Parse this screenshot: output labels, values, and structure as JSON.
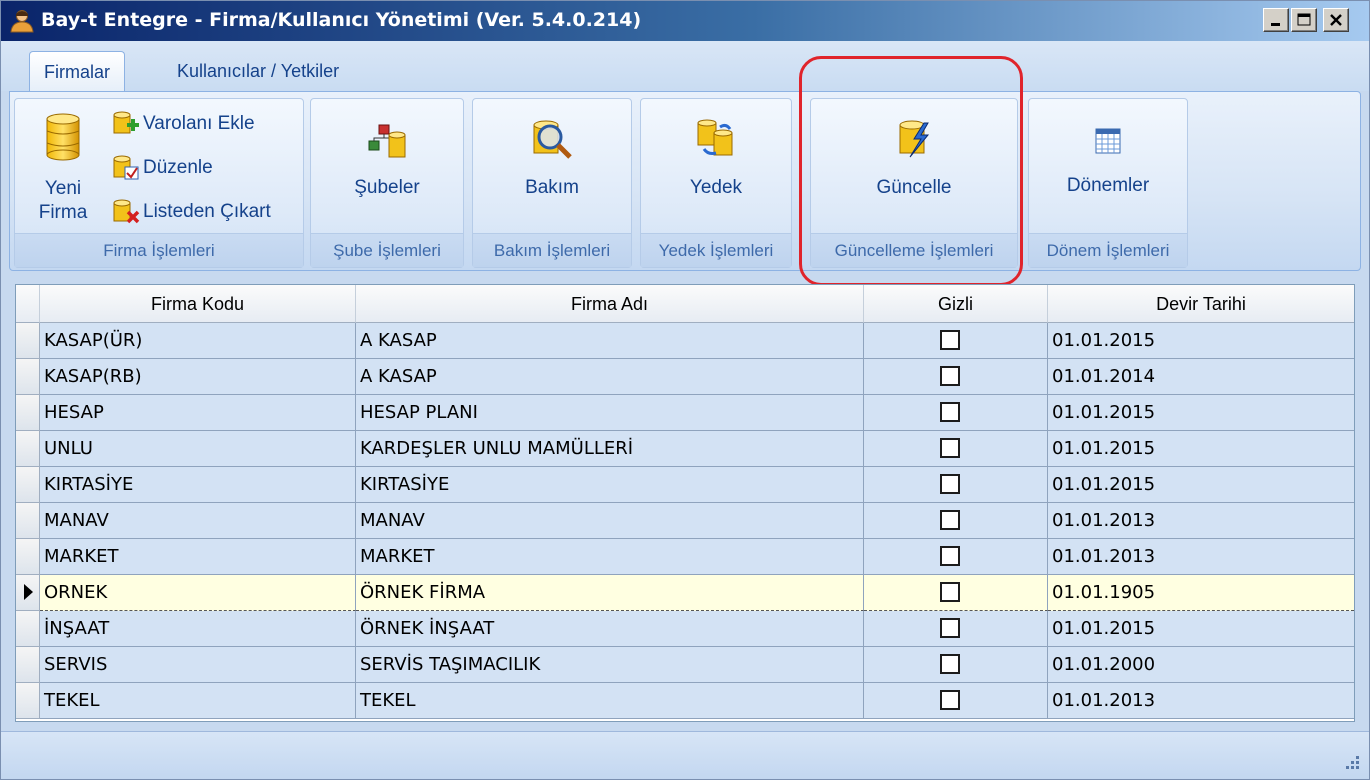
{
  "window": {
    "title": "Bay-t Entegre - Firma/Kullanıcı Yönetimi (Ver. 5.4.0.214)"
  },
  "tabs": [
    {
      "label": "Firmalar",
      "active": true
    },
    {
      "label": "Kullanıcılar / Yetkiler",
      "active": false
    }
  ],
  "ribbon": {
    "firma": {
      "new_line1": "Yeni",
      "new_line2": "Firma",
      "add_existing": "Varolanı Ekle",
      "edit": "Düzenle",
      "remove": "Listeden Çıkart",
      "group_label": "Firma İşlemleri"
    },
    "sube": {
      "button": "Şubeler",
      "group_label": "Şube İşlemleri"
    },
    "bakim": {
      "button": "Bakım",
      "group_label": "Bakım İşlemleri"
    },
    "yedek": {
      "button": "Yedek",
      "group_label": "Yedek İşlemleri"
    },
    "guncelleme": {
      "button": "Güncelle",
      "group_label": "Güncelleme İşlemleri"
    },
    "donem": {
      "button": "Dönemler",
      "group_label": "Dönem İşlemleri"
    }
  },
  "grid": {
    "columns": [
      "Firma Kodu",
      "Firma Adı",
      "Gizli",
      "Devir Tarihi"
    ],
    "rows": [
      {
        "code": "KASAP(ÜR)",
        "name": "A KASAP",
        "hidden": false,
        "date": "01.01.2015"
      },
      {
        "code": "KASAP(RB)",
        "name": "A KASAP",
        "hidden": false,
        "date": "01.01.2014"
      },
      {
        "code": "HESAP",
        "name": "HESAP PLANI",
        "hidden": false,
        "date": "01.01.2015"
      },
      {
        "code": "UNLU",
        "name": "KARDEŞLER UNLU MAMÜLLERİ",
        "hidden": false,
        "date": "01.01.2015"
      },
      {
        "code": "KIRTASİYE",
        "name": "KIRTASİYE",
        "hidden": false,
        "date": "01.01.2015"
      },
      {
        "code": "MANAV",
        "name": "MANAV",
        "hidden": false,
        "date": "01.01.2013"
      },
      {
        "code": "MARKET",
        "name": "MARKET",
        "hidden": false,
        "date": "01.01.2013"
      },
      {
        "code": "ORNEK",
        "name": "ÖRNEK FİRMA",
        "hidden": false,
        "date": "01.01.1905",
        "selected": true
      },
      {
        "code": "İNŞAAT",
        "name": "ÖRNEK İNŞAAT",
        "hidden": false,
        "date": "01.01.2015"
      },
      {
        "code": "SERVIS",
        "name": "SERVİS TAŞIMACILIK",
        "hidden": false,
        "date": "01.01.2000"
      },
      {
        "code": "TEKEL",
        "name": "TEKEL",
        "hidden": false,
        "date": "01.01.2013"
      }
    ]
  },
  "colors": {
    "highlight": "#e0242b",
    "selected_row": "#ffffe1",
    "row": "#d3e2f4"
  }
}
